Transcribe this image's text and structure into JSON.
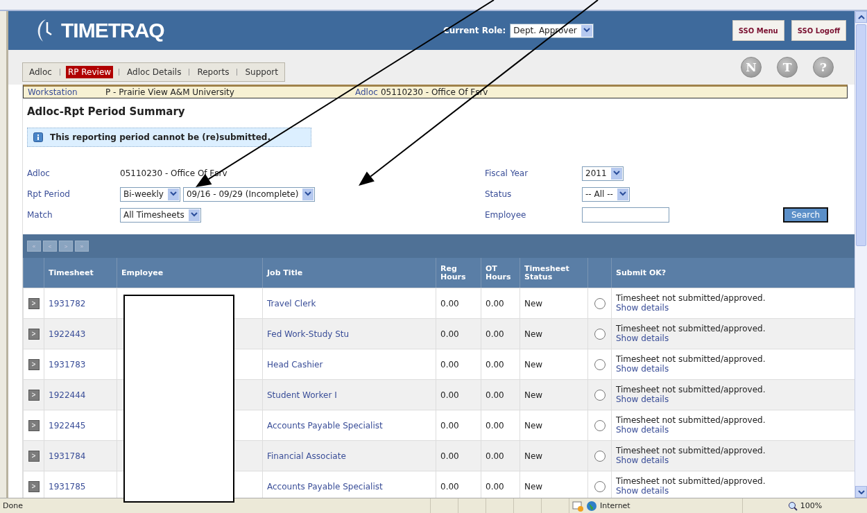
{
  "header": {
    "logo": "TIMETRAQ",
    "role_label": "Current Role:",
    "role": "Dept. Approver",
    "buttons": [
      "SSO Menu",
      "SSO Logoff"
    ]
  },
  "nav": {
    "tabs": [
      {
        "label": "Adloc",
        "selected": false
      },
      {
        "label": "RP Review",
        "selected": true
      },
      {
        "label": "Adloc Details",
        "selected": false
      },
      {
        "label": "Reports",
        "selected": false
      },
      {
        "label": "Support",
        "selected": false
      }
    ],
    "icon_buttons": [
      "N",
      "T",
      "?"
    ]
  },
  "workstation": {
    "label": "Workstation",
    "value": "P - Prairie View A&M University",
    "adloc_label": "Adloc",
    "adloc_value": "05110230 - Office Of Fsrv"
  },
  "title": "Adloc-Rpt Period Summary",
  "info": "This reporting period cannot be (re)submitted.",
  "form": {
    "left": [
      {
        "label": "Adloc",
        "kind": "text",
        "values": [
          "05110230 - Office Of Fsrv"
        ]
      },
      {
        "label": "Rpt Period",
        "kind": "select",
        "values": [
          "Bi-weekly",
          "09/16 - 09/29 (Incomplete)"
        ]
      },
      {
        "label": "Match",
        "kind": "select",
        "values": [
          "All Timesheets"
        ]
      }
    ],
    "right": [
      {
        "label": "Fiscal Year",
        "kind": "select",
        "values": [
          "2011"
        ]
      },
      {
        "label": "Status",
        "kind": "select",
        "values": [
          "-- All --"
        ]
      },
      {
        "label": "Employee",
        "kind": "input"
      }
    ],
    "search_button": "Search"
  },
  "pager": [
    "«",
    "<",
    ">",
    "»"
  ],
  "table": {
    "columns": [
      "Timesheet",
      "Employee",
      "Job Title",
      "Reg Hours",
      "OT Hours",
      "Timesheet Status",
      "Submit OK?"
    ],
    "rows": [
      {
        "expander": ">",
        "timesheet": "1931782",
        "job": "Travel Clerk",
        "reg": "0.00",
        "ot": "0.00",
        "status": "New",
        "selected": false,
        "message": "Timesheet not submitted/approved.",
        "link": "Show details"
      },
      {
        "expander": ">",
        "timesheet": "1922443",
        "job": "Fed Work-Study Stu",
        "reg": "0.00",
        "ot": "0.00",
        "status": "New",
        "selected": false,
        "message": "Timesheet not submitted/approved.",
        "link": "Show details"
      },
      {
        "expander": ">",
        "timesheet": "1931783",
        "job": "Head Cashier",
        "reg": "0.00",
        "ot": "0.00",
        "status": "New",
        "selected": false,
        "message": "Timesheet not submitted/approved.",
        "link": "Show details"
      },
      {
        "expander": ">",
        "timesheet": "1922444",
        "job": "Student Worker I",
        "reg": "0.00",
        "ot": "0.00",
        "status": "New",
        "selected": false,
        "message": "Timesheet not submitted/approved.",
        "link": "Show details"
      },
      {
        "expander": ">",
        "timesheet": "1922445",
        "job": "Accounts Payable Specialist",
        "reg": "0.00",
        "ot": "0.00",
        "status": "New",
        "selected": false,
        "message": "Timesheet not submitted/approved.",
        "link": "Show details"
      },
      {
        "expander": ">",
        "timesheet": "1931784",
        "job": "Financial Associate",
        "reg": "0.00",
        "ot": "0.00",
        "status": "New",
        "selected": false,
        "message": "Timesheet not submitted/approved.",
        "link": "Show details"
      },
      {
        "expander": ">",
        "timesheet": "1931785",
        "job": "Accounts Payable Specialist",
        "reg": "0.00",
        "ot": "0.00",
        "status": "New",
        "selected": false,
        "message": "Timesheet not submitted/approved.",
        "link": "Show details"
      }
    ]
  },
  "status_bar": {
    "text": "Done",
    "zone": "Internet",
    "zoom": "100%"
  }
}
